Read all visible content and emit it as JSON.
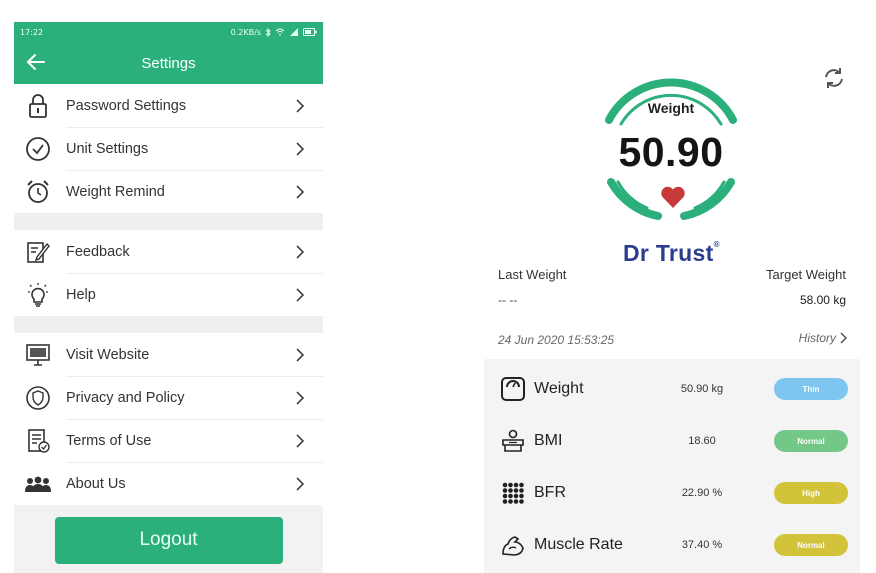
{
  "settings_screen": {
    "status_bar": {
      "time": "17:22",
      "speed": "0.2KB/s"
    },
    "app_bar": {
      "title": "Settings"
    },
    "groups": [
      [
        {
          "label": "Password Settings",
          "icon": "lock-icon"
        },
        {
          "label": "Unit Settings",
          "icon": "check-circle-icon"
        },
        {
          "label": "Weight Remind",
          "icon": "alarm-clock-icon"
        }
      ],
      [
        {
          "label": "Feedback",
          "icon": "pencil-note-icon"
        },
        {
          "label": "Help",
          "icon": "lightbulb-icon"
        }
      ],
      [
        {
          "label": "Visit Website",
          "icon": "monitor-icon"
        },
        {
          "label": "Privacy and Policy",
          "icon": "shield-icon"
        },
        {
          "label": "Terms of Use",
          "icon": "document-icon"
        },
        {
          "label": "About Us",
          "icon": "group-icon"
        }
      ]
    ],
    "logout_label": "Logout",
    "accent_color": "#2bb07b"
  },
  "weight_screen": {
    "gauge": {
      "label": "Weight",
      "value": "50.90"
    },
    "brand": {
      "name": "Dr Trust",
      "mark": "®"
    },
    "last_weight": {
      "label": "Last Weight",
      "value": "-- --"
    },
    "target_weight": {
      "label": "Target Weight",
      "value": "58.00 kg"
    },
    "timestamp": "24 Jun 2020 15:53:25",
    "history_label": "History",
    "metrics": [
      {
        "name": "Weight",
        "value": "50.90 kg",
        "status": "Thin",
        "status_color": "#7cc6f0",
        "icon": "scale-icon"
      },
      {
        "name": "BMI",
        "value": "18.60",
        "status": "Normal",
        "status_color": "#73c887",
        "icon": "bmi-person-icon"
      },
      {
        "name": "BFR",
        "value": "22.90 %",
        "status": "High",
        "status_color": "#d2c33a",
        "icon": "body-fat-icon"
      },
      {
        "name": "Muscle Rate",
        "value": "37.40 %",
        "status": "Normal",
        "status_color": "#d2c33a",
        "icon": "muscle-arm-icon"
      }
    ],
    "accent_color": "#2bb07b"
  }
}
